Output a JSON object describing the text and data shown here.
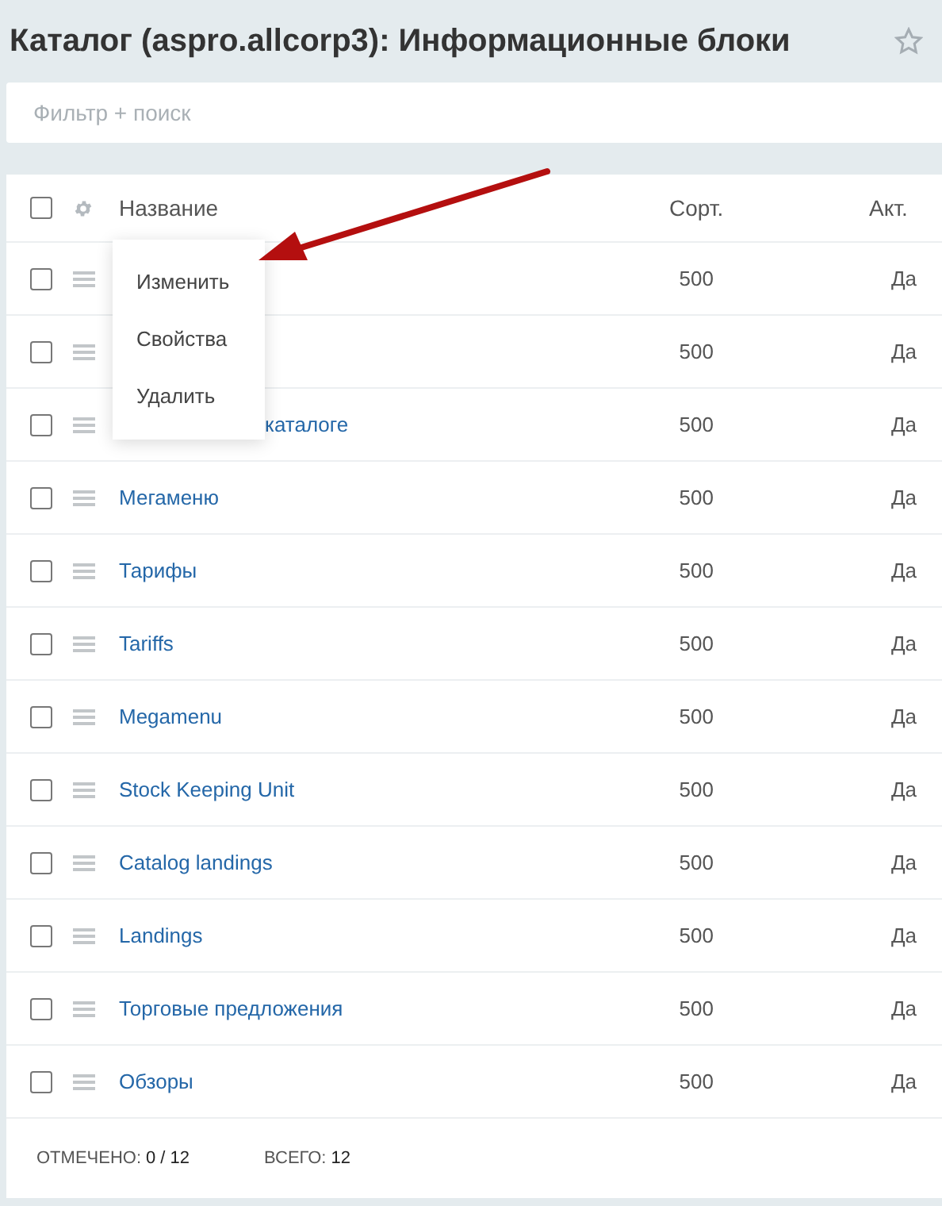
{
  "title": "Каталог (aspro.allcorp3): Информационные блоки",
  "filter": {
    "placeholder": "Фильтр + поиск"
  },
  "table": {
    "all_checked": false,
    "columns": [
      "Название",
      "Сорт.",
      "Акт."
    ],
    "rows": [
      {
        "checked": false,
        "sort": "500",
        "active": "Да"
      },
      {
        "checked": false,
        "sort": "500",
        "active": "Да"
      },
      {
        "checked": false,
        "name": "каталоге",
        "covered": true,
        "sort": "500",
        "active": "Да"
      },
      {
        "checked": false,
        "name": "Мегаменю",
        "sort": "500",
        "active": "Да"
      },
      {
        "checked": false,
        "name": "Тарифы",
        "sort": "500",
        "active": "Да"
      },
      {
        "checked": false,
        "name": "Tariffs",
        "sort": "500",
        "active": "Да"
      },
      {
        "checked": false,
        "name": "Megamenu",
        "sort": "500",
        "active": "Да"
      },
      {
        "checked": false,
        "name": "Stock Keeping Unit",
        "sort": "500",
        "active": "Да"
      },
      {
        "checked": false,
        "name": "Catalog landings",
        "sort": "500",
        "active": "Да"
      },
      {
        "checked": false,
        "name": "Landings",
        "sort": "500",
        "active": "Да"
      },
      {
        "checked": false,
        "name": "Торговые предложения",
        "sort": "500",
        "active": "Да"
      },
      {
        "checked": false,
        "name": "Обзоры",
        "sort": "500",
        "active": "Да"
      }
    ]
  },
  "context_menu": [
    "Изменить",
    "Свойства",
    "Удалить"
  ],
  "footer": {
    "checked_label": "ОТМЕЧЕНО:",
    "checked_value": "0 / 12",
    "total_label": "ВСЕГО:",
    "total_value": "12"
  }
}
